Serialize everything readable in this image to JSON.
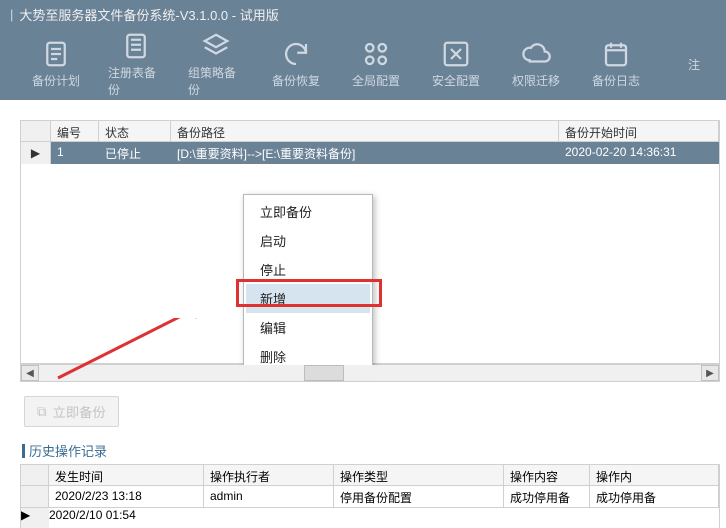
{
  "window": {
    "title": "大势至服务器文件备份系统-V3.1.0.0 - 试用版"
  },
  "toolbar": {
    "items": [
      {
        "label": "备份计划"
      },
      {
        "label": "注册表备份"
      },
      {
        "label": "组策略备份"
      },
      {
        "label": "备份恢复"
      },
      {
        "label": "全局配置"
      },
      {
        "label": "安全配置"
      },
      {
        "label": "权限迁移"
      },
      {
        "label": "备份日志"
      }
    ],
    "right_label": "注"
  },
  "grid": {
    "headers": {
      "num": "编号",
      "status": "状态",
      "path": "备份路径",
      "start": "备份开始时间"
    },
    "row": {
      "num": "1",
      "status": "已停止",
      "path": "[D:\\重要资料]-->[E:\\重要资料备份]",
      "start": "2020-02-20 14:36:31"
    }
  },
  "context_menu": {
    "items": [
      "立即备份",
      "启动",
      "停止",
      "新增",
      "编辑",
      "删除"
    ],
    "highlighted_index": 3
  },
  "action_button": "立即备份",
  "history_title": "历史操作记录",
  "history": {
    "headers": {
      "time": "发生时间",
      "actor": "操作执行者",
      "type": "操作类型",
      "content": "操作内容",
      "content2": "操作内"
    },
    "rows": [
      {
        "time": "2020/2/23 13:18",
        "actor": "admin",
        "type": "停用备份配置",
        "content": "成功停用备",
        "content2": "成功停用备"
      },
      {
        "time": "2020/2/10 01:54",
        "actor": "",
        "type": "",
        "content": "",
        "content2": ""
      }
    ]
  }
}
